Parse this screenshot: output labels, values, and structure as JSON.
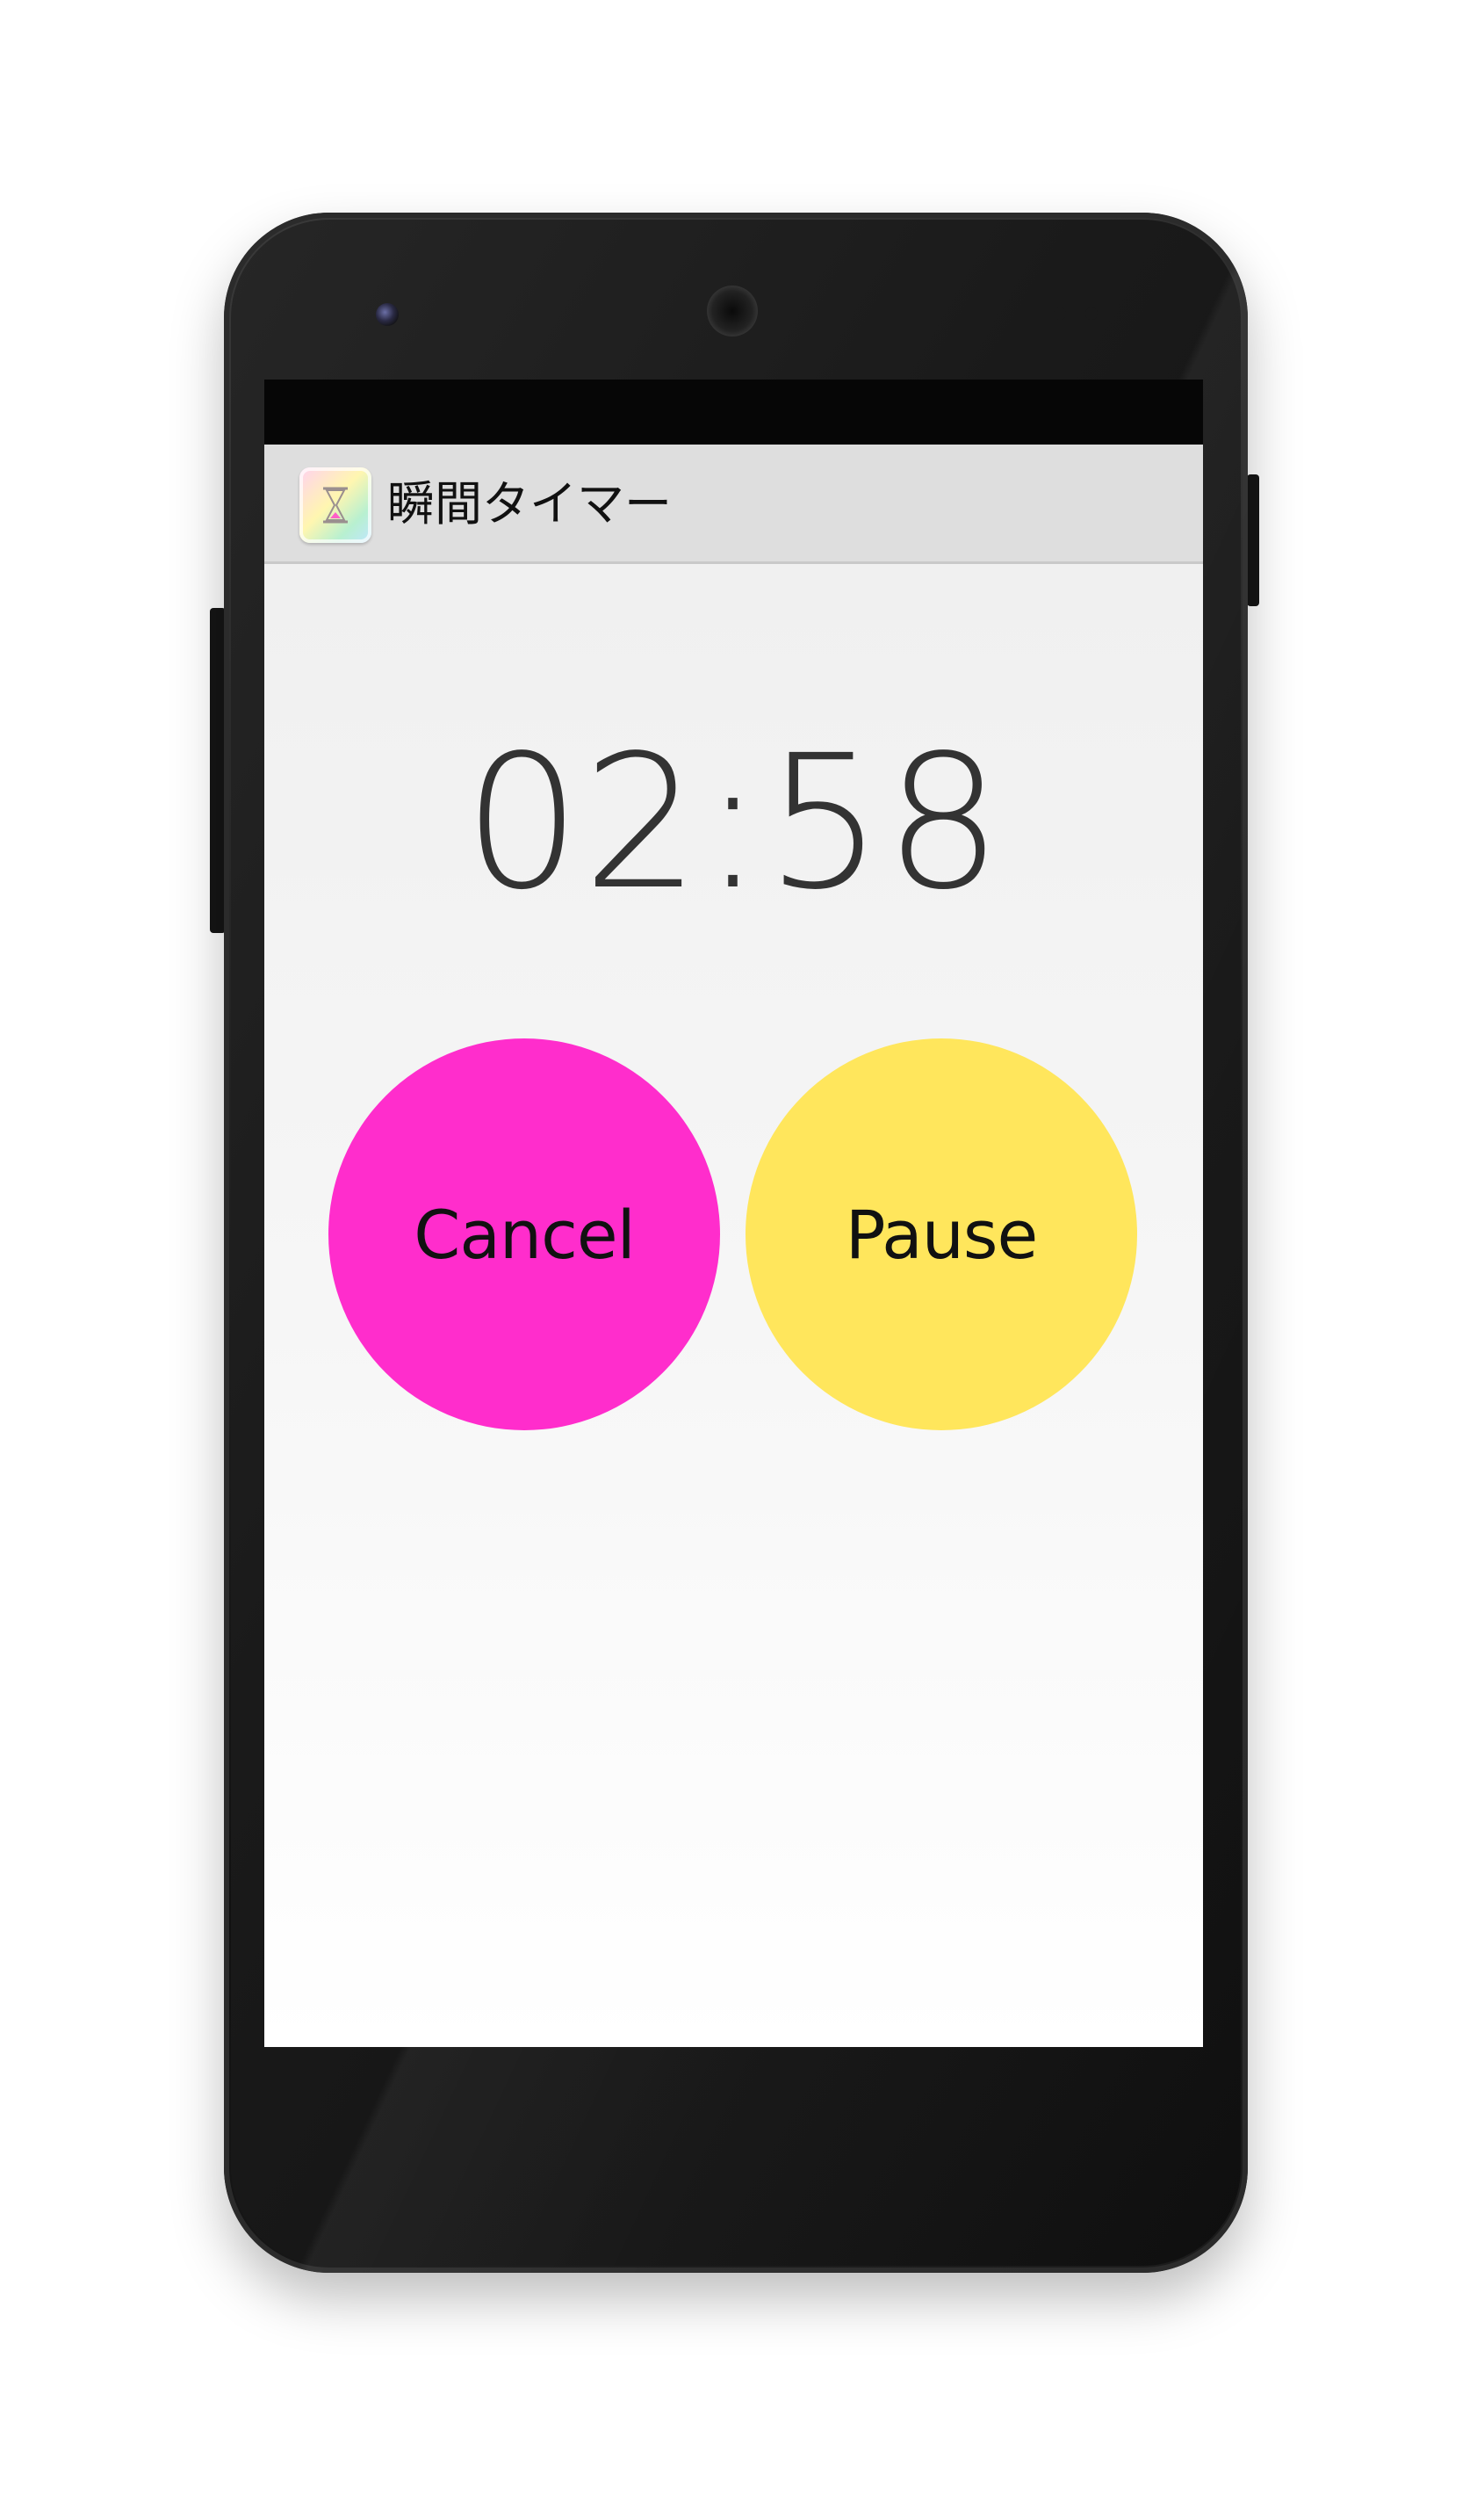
{
  "app": {
    "title": "瞬間タイマー",
    "icon": "hourglass-icon"
  },
  "timer": {
    "display": "02:58"
  },
  "buttons": {
    "cancel_label": "Cancel",
    "pause_label": "Pause"
  },
  "colors": {
    "cancel": "#ff2dcc",
    "pause": "#ffe65c",
    "action_bar": "#dedede",
    "timer_text": "#333333"
  }
}
